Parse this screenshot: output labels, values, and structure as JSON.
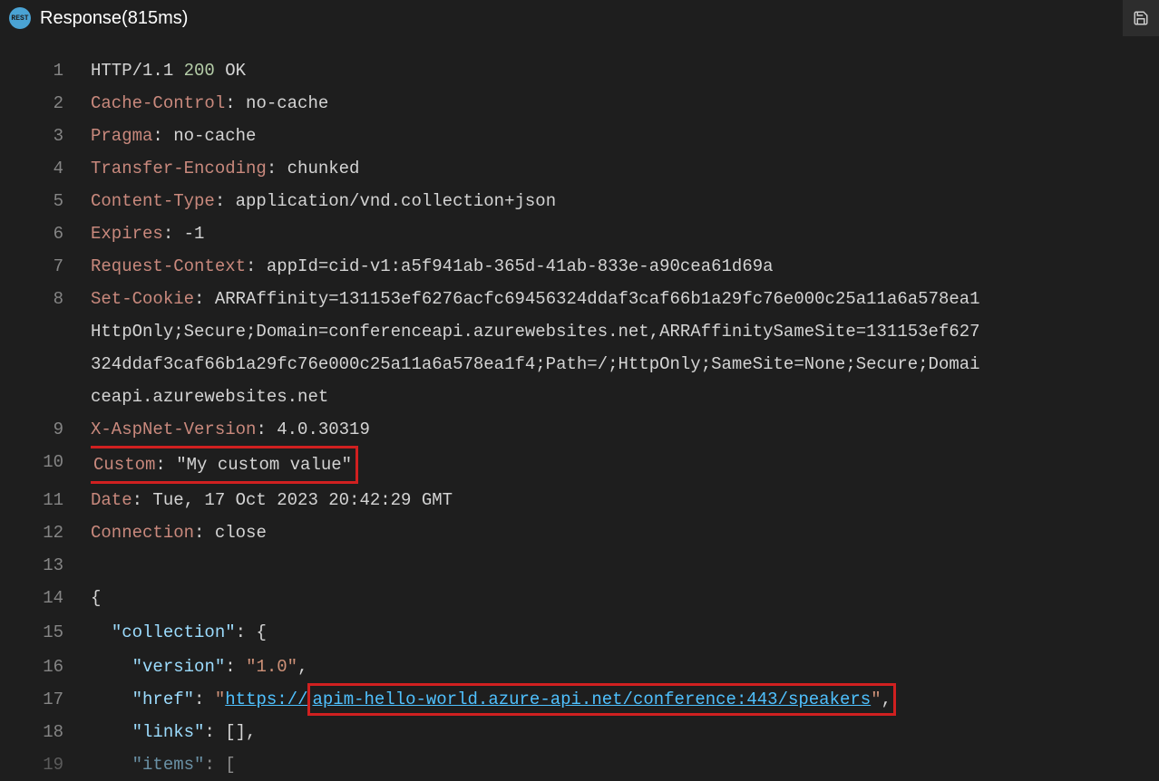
{
  "header": {
    "title": "Response(815ms)",
    "icon_label": "REST"
  },
  "code": {
    "lines": [
      {
        "n": "1",
        "segments": [
          {
            "t": "HTTP/1.1 ",
            "c": "text"
          },
          {
            "t": "200",
            "c": "number"
          },
          {
            "t": " OK",
            "c": "text"
          }
        ]
      },
      {
        "n": "2",
        "segments": [
          {
            "t": "Cache-Control",
            "c": "header"
          },
          {
            "t": ": no-cache",
            "c": "text"
          }
        ]
      },
      {
        "n": "3",
        "segments": [
          {
            "t": "Pragma",
            "c": "header"
          },
          {
            "t": ": no-cache",
            "c": "text"
          }
        ]
      },
      {
        "n": "4",
        "segments": [
          {
            "t": "Transfer-Encoding",
            "c": "header"
          },
          {
            "t": ": chunked",
            "c": "text"
          }
        ]
      },
      {
        "n": "5",
        "segments": [
          {
            "t": "Content-Type",
            "c": "header"
          },
          {
            "t": ": application/vnd.collection+json",
            "c": "text"
          }
        ]
      },
      {
        "n": "6",
        "segments": [
          {
            "t": "Expires",
            "c": "header"
          },
          {
            "t": ": -1",
            "c": "text"
          }
        ]
      },
      {
        "n": "7",
        "segments": [
          {
            "t": "Request-Context",
            "c": "header"
          },
          {
            "t": ": appId=cid-v1:a5f941ab-365d-41ab-833e-a90cea61d69a",
            "c": "text"
          }
        ]
      },
      {
        "n": "8",
        "segments": [
          {
            "t": "Set-Cookie",
            "c": "header"
          },
          {
            "t": ": ARRAffinity=131153ef6276acfc69456324ddaf3caf66b1a29fc76e000c25a11a6a578ea1",
            "c": "text"
          }
        ],
        "wrap": [
          "HttpOnly;Secure;Domain=conferenceapi.azurewebsites.net,ARRAffinitySameSite=131153ef627",
          "324ddaf3caf66b1a29fc76e000c25a11a6a578ea1f4;Path=/;HttpOnly;SameSite=None;Secure;Domai",
          "ceapi.azurewebsites.net"
        ]
      },
      {
        "n": "9",
        "segments": [
          {
            "t": "X-AspNet-Version",
            "c": "header"
          },
          {
            "t": ": 4.0.30319",
            "c": "text"
          }
        ]
      },
      {
        "n": "10",
        "highlight": true,
        "segments": [
          {
            "t": "Custom",
            "c": "header"
          },
          {
            "t": ": \"My custom value\"",
            "c": "text"
          }
        ]
      },
      {
        "n": "11",
        "segments": [
          {
            "t": "Date",
            "c": "header"
          },
          {
            "t": ": Tue, 17 Oct 2023 20:42:29 GMT",
            "c": "text"
          }
        ]
      },
      {
        "n": "12",
        "segments": [
          {
            "t": "Connection",
            "c": "header"
          },
          {
            "t": ": close",
            "c": "text"
          }
        ]
      },
      {
        "n": "13",
        "segments": []
      },
      {
        "n": "14",
        "fold": true,
        "segments": [
          {
            "t": "{",
            "c": "text"
          }
        ]
      },
      {
        "n": "15",
        "fold": true,
        "indent": 1,
        "segments": [
          {
            "t": "\"collection\"",
            "c": "key"
          },
          {
            "t": ": {",
            "c": "text"
          }
        ]
      },
      {
        "n": "16",
        "indent": 2,
        "segments": [
          {
            "t": "\"version\"",
            "c": "key"
          },
          {
            "t": ": ",
            "c": "text"
          },
          {
            "t": "\"1.0\"",
            "c": "string"
          },
          {
            "t": ",",
            "c": "text"
          }
        ]
      },
      {
        "n": "17",
        "indent": 2,
        "href_highlight": true,
        "segments": [
          {
            "t": "\"href\"",
            "c": "key"
          },
          {
            "t": ": ",
            "c": "text"
          },
          {
            "t": "\"",
            "c": "string"
          },
          {
            "t": "https://apim-hello-world.azure-api.net/conference:443/speakers",
            "c": "link"
          },
          {
            "t": "\"",
            "c": "string"
          },
          {
            "t": ",",
            "c": "text"
          }
        ]
      },
      {
        "n": "18",
        "indent": 2,
        "segments": [
          {
            "t": "\"links\"",
            "c": "key"
          },
          {
            "t": ": [],",
            "c": "text"
          }
        ]
      },
      {
        "n": "19",
        "fold": true,
        "indent": 2,
        "segments": [
          {
            "t": "\"items\"",
            "c": "key"
          },
          {
            "t": ": [",
            "c": "text"
          }
        ],
        "partial": true
      }
    ]
  }
}
